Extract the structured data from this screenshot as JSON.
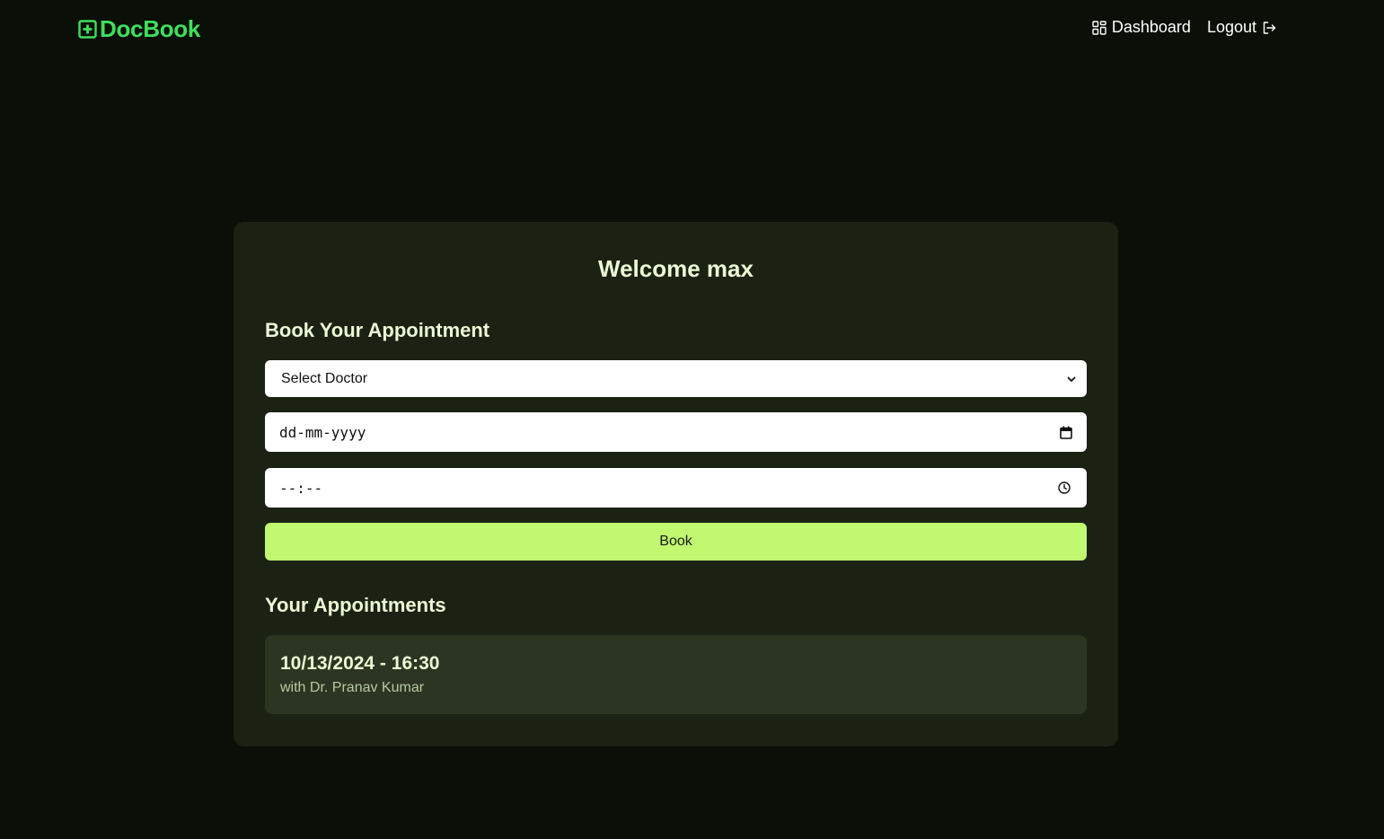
{
  "brand": {
    "name": "DocBook",
    "icon": "plus-square-icon",
    "color": "#3ee05a"
  },
  "nav": {
    "dashboard": {
      "label": "Dashboard",
      "icon": "grid-icon"
    },
    "logout": {
      "label": "Logout",
      "icon": "logout-icon"
    }
  },
  "card": {
    "welcome": "Welcome max",
    "book_title": "Book Your Appointment",
    "doctor_select": {
      "selected": "Select Doctor"
    },
    "date_input": {
      "placeholder": "dd-mm-yyyy",
      "icon": "calendar-icon"
    },
    "time_input": {
      "placeholder": "--:--",
      "icon": "clock-icon"
    },
    "book_button": "Book",
    "appointments_title": "Your Appointments",
    "appointments": [
      {
        "when": "10/13/2024 - 16:30",
        "with": "with Dr. Pranav Kumar"
      }
    ]
  },
  "colors": {
    "background": "#0a0f07",
    "card": "#1b2113",
    "accent_button": "#c0f870",
    "appointment_bg": "#2c3522"
  }
}
